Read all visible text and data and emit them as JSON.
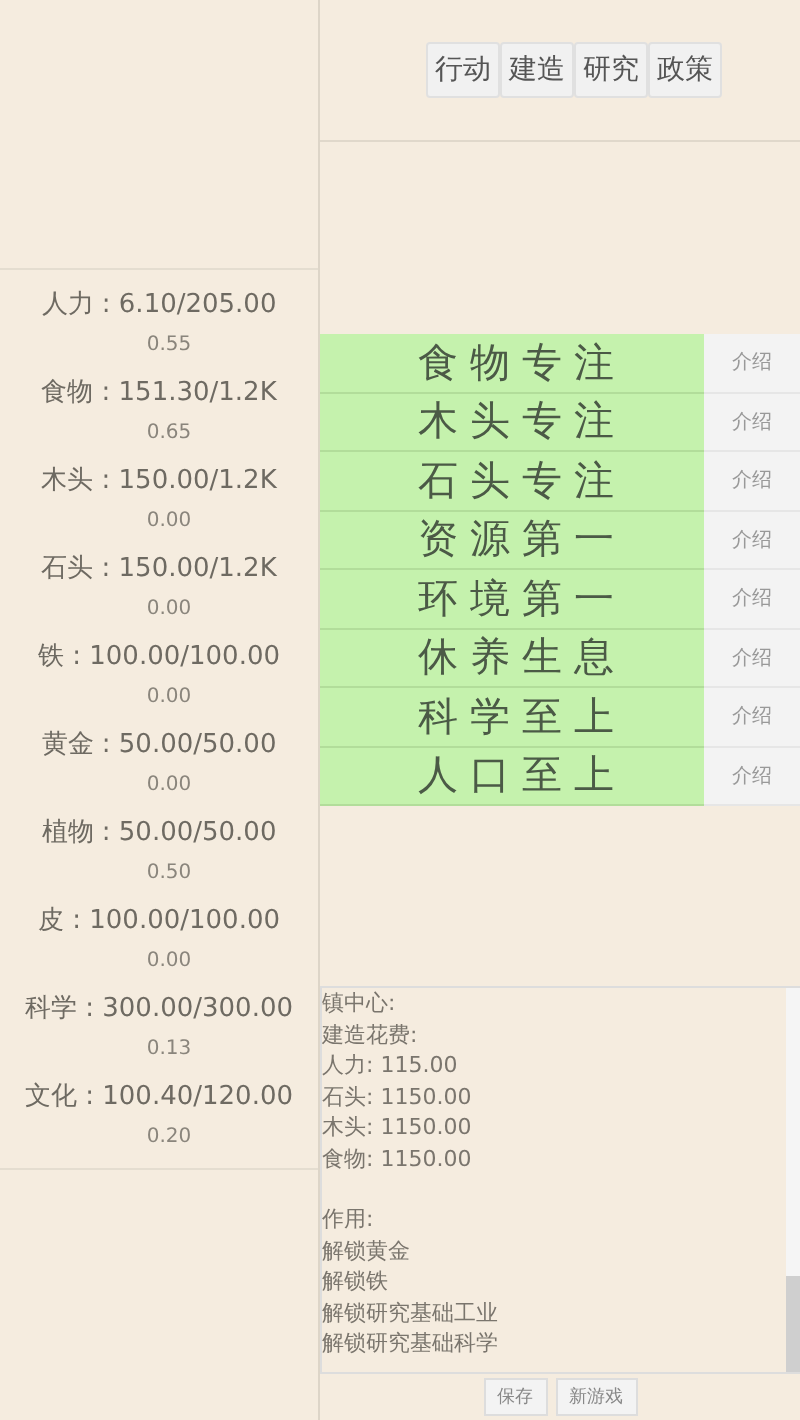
{
  "tabs": [
    {
      "label": "行动"
    },
    {
      "label": "建造"
    },
    {
      "label": "研究"
    },
    {
      "label": "政策"
    }
  ],
  "resources": [
    {
      "amount": "人力 : 6.10/205.00",
      "rate": "0.55"
    },
    {
      "amount": "食物 : 151.30/1.2K",
      "rate": "0.65"
    },
    {
      "amount": "木头 : 150.00/1.2K",
      "rate": "0.00"
    },
    {
      "amount": "石头 : 150.00/1.2K",
      "rate": "0.00"
    },
    {
      "amount": "铁 : 100.00/100.00",
      "rate": "0.00"
    },
    {
      "amount": "黄金 : 50.00/50.00",
      "rate": "0.00"
    },
    {
      "amount": "植物 : 50.00/50.00",
      "rate": "0.50"
    },
    {
      "amount": "皮 : 100.00/100.00",
      "rate": "0.00"
    },
    {
      "amount": "科学 : 300.00/300.00",
      "rate": "0.13"
    },
    {
      "amount": "文化 : 100.40/120.00",
      "rate": "0.20"
    }
  ],
  "policies": [
    {
      "label": "食物专注",
      "info": "介绍"
    },
    {
      "label": "木头专注",
      "info": "介绍"
    },
    {
      "label": "石头专注",
      "info": "介绍"
    },
    {
      "label": "资源第一",
      "info": "介绍"
    },
    {
      "label": "环境第一",
      "info": "介绍"
    },
    {
      "label": "休养生息",
      "info": "介绍"
    },
    {
      "label": "科学至上",
      "info": "介绍"
    },
    {
      "label": "人口至上",
      "info": "介绍"
    }
  ],
  "details": {
    "paragraphs": [
      [
        "镇中心:",
        "建造花费:",
        "人力: 115.00",
        "石头: 1150.00",
        "木头: 1150.00",
        "食物: 1150.00"
      ],
      [
        "作用:",
        "解锁黄金",
        "解锁铁",
        "解锁研究基础工业",
        "解锁研究基础科学"
      ]
    ]
  },
  "footer_buttons": [
    "保存",
    "新游戏"
  ]
}
